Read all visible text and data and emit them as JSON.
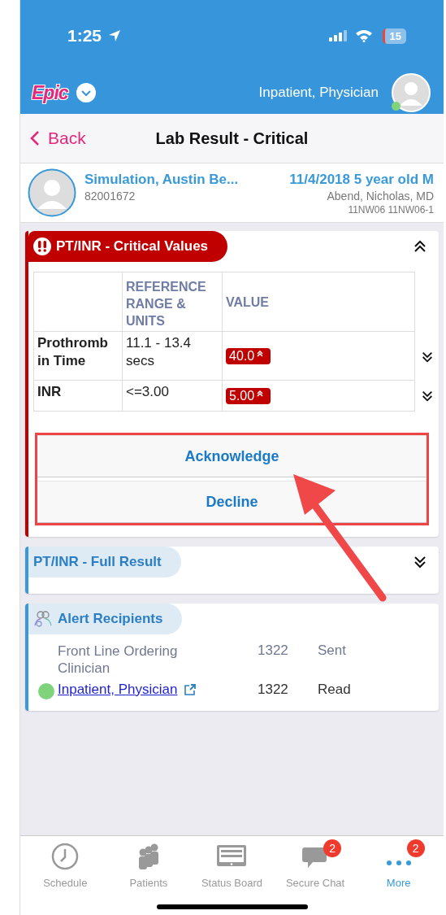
{
  "status_bar": {
    "time": "1:25",
    "battery": "15"
  },
  "header": {
    "logo": "Epic",
    "user": "Inpatient, Physician",
    "online": true
  },
  "nav": {
    "back": "Back",
    "title": "Lab Result - Critical"
  },
  "patient": {
    "name": "Simulation, Austin Be...",
    "mrn": "82001672",
    "info": "11/4/2018 5 year old M",
    "provider": "Abend, Nicholas, MD",
    "location": "11NW06 11NW06-1"
  },
  "critical": {
    "title": "PT/INR - Critical Values",
    "expanded": true,
    "columns": [
      "REFERENCE RANGE & UNITS",
      "VALUE"
    ],
    "rows": [
      {
        "name": "Prothromb in Time",
        "range": "11.1 - 13.4 secs",
        "value": "40.0",
        "high": true,
        "expanded": false
      },
      {
        "name": "INR",
        "range": "<=3.00",
        "value": "5.00",
        "high": true,
        "expanded": false
      }
    ],
    "buttons": [
      "Acknowledge",
      "Decline"
    ]
  },
  "full_result": {
    "title": "PT/INR - Full Result",
    "expanded": false
  },
  "recipients": {
    "title": "Alert Recipients",
    "rows": [
      {
        "kind": "group",
        "recipient": "Front Line Ordering Clinician",
        "code": "1322",
        "status": "Sent"
      },
      {
        "kind": "user",
        "recipient": "Inpatient, Physician",
        "online": true,
        "code": "1322",
        "status": "Read"
      }
    ]
  },
  "tabs": [
    {
      "label": "Schedule",
      "selected": false
    },
    {
      "label": "Patients",
      "selected": false
    },
    {
      "label": "Status Board",
      "selected": false
    },
    {
      "label": "Secure Chat",
      "badge": "2",
      "selected": false
    },
    {
      "label": "More",
      "badge": "2",
      "selected": true
    }
  ]
}
